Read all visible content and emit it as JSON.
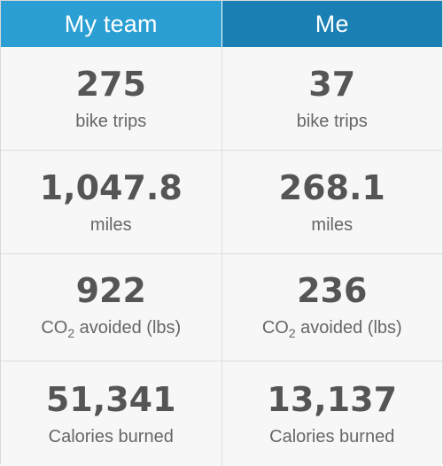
{
  "tabs": {
    "team_label": "My team",
    "me_label": "Me"
  },
  "stats": {
    "team": [
      {
        "value": "275",
        "label": "bike trips"
      },
      {
        "value": "1,047.8",
        "label": "miles"
      },
      {
        "value": "922",
        "label_prefix": "CO",
        "label_sub": "2",
        "label_suffix": " avoided (lbs)"
      },
      {
        "value": "51,341",
        "label": "Calories burned"
      }
    ],
    "me": [
      {
        "value": "37",
        "label": "bike trips"
      },
      {
        "value": "268.1",
        "label": "miles"
      },
      {
        "value": "236",
        "label_prefix": "CO",
        "label_sub": "2",
        "label_suffix": " avoided (lbs)"
      },
      {
        "value": "13,137",
        "label": "Calories burned"
      }
    ]
  }
}
